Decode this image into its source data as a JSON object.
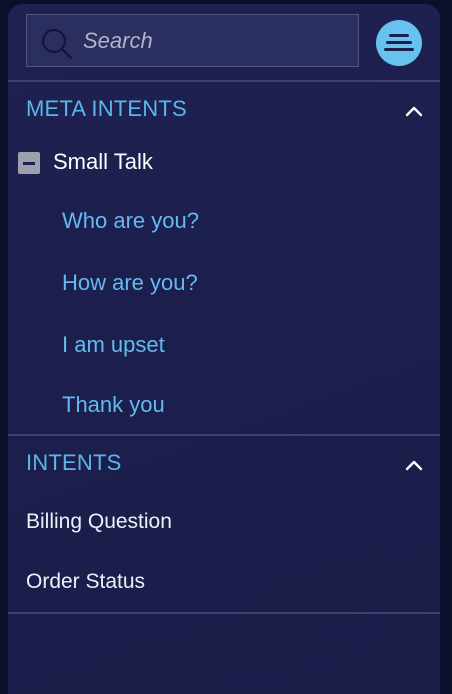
{
  "search": {
    "placeholder": "Search",
    "value": ""
  },
  "menu_button": {
    "icon": "menu-icon",
    "color": "#67c2ef"
  },
  "sections": {
    "meta_intents": {
      "title": "META INTENTS",
      "expanded": true,
      "group": {
        "label": "Small Talk",
        "expanded": true,
        "items": [
          "Who are you?",
          "How are you?",
          "I am upset",
          "Thank you"
        ]
      }
    },
    "intents": {
      "title": "INTENTS",
      "expanded": true,
      "items": [
        "Billing Question",
        "Order Status"
      ]
    }
  },
  "colors": {
    "accent": "#5bb6ea",
    "panel_bg": "#1c1f4c",
    "page_bg": "#0a0f2a"
  }
}
